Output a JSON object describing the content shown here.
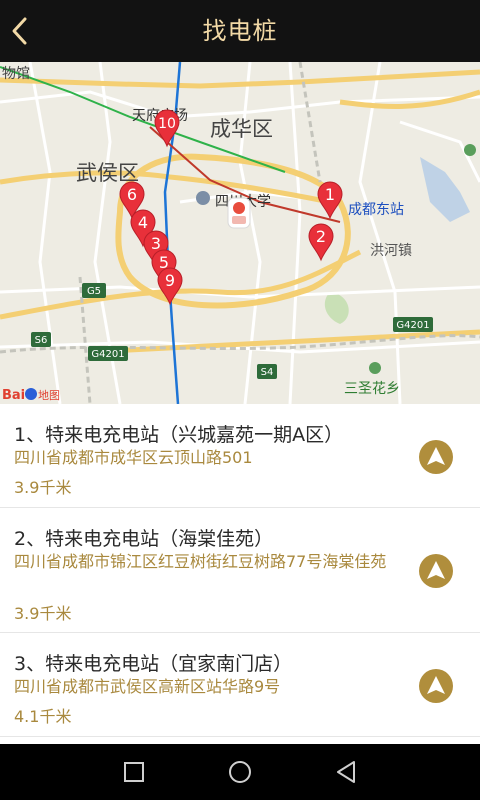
{
  "header": {
    "title": "找电桩",
    "back_icon": "chevron-left-icon"
  },
  "map": {
    "labels": {
      "museum": "物馆",
      "tianfu": "天府广场",
      "chenghua": "成华区",
      "wuhou": "武侯区",
      "sichuan_univ": "四川大学",
      "chengdu_east": "成都东站",
      "honghe": "洪河镇",
      "sansheng": "三圣花乡",
      "g5": "G5",
      "s6": "S6",
      "g4201_left": "G4201",
      "g4201_right": "G4201",
      "s4": "S4",
      "baidu": "Bai",
      "baidu_map": "地图"
    },
    "pins": [
      "10",
      "6",
      "4",
      "3",
      "5",
      "9",
      "1",
      "2"
    ]
  },
  "stations": [
    {
      "name": "1、特来电充电站（兴城嘉苑一期A区）",
      "address": "四川省成都市成华区云顶山路501",
      "distance": "3.9千米"
    },
    {
      "name": "2、特来电充电站（海棠佳苑）",
      "address": "四川省成都市锦江区红豆树街红豆树路77号海棠佳苑",
      "distance": "3.9千米"
    },
    {
      "name": "3、特来电充电站（宜家南门店）",
      "address": "四川省成都市武侯区高新区站华路9号",
      "distance": "4.1千米"
    }
  ],
  "colors": {
    "header_bg": "#121212",
    "title": "#f2d9a6",
    "accent": "#b08e3c",
    "pin": "#e8303a"
  },
  "system_nav": [
    "square-icon",
    "circle-icon",
    "triangle-back-icon"
  ]
}
